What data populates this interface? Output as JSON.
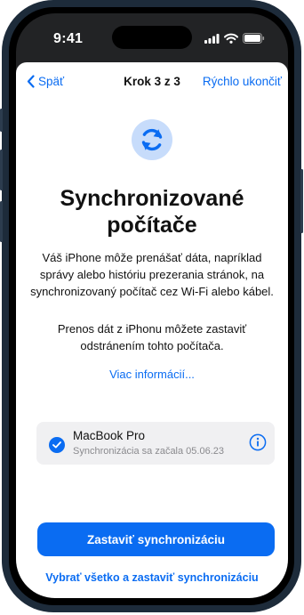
{
  "status_bar": {
    "time": "9:41"
  },
  "nav": {
    "back_label": "Späť",
    "title": "Krok 3 z 3",
    "action_label": "Rýchlo ukončiť"
  },
  "main": {
    "icon": "sync-icon",
    "heading_line1": "Synchronizované",
    "heading_line2": "počítače",
    "description": "Váš iPhone môže prenášať dáta, napríklad správy alebo históriu prezerania stránok, na synchronizovaný počítač cez Wi-Fi alebo kábel.",
    "description_2": "Prenos dát z iPhonu môžete zastaviť odstránením tohto počítača.",
    "more_link": "Viac informácií..."
  },
  "device": {
    "name": "MacBook Pro",
    "status": "Synchronizácia sa začala 05.06.23",
    "selected": true
  },
  "actions": {
    "primary": "Zastaviť synchronizáciu",
    "secondary": "Vybrať všetko a zastaviť synchronizáciu"
  },
  "colors": {
    "accent": "#0a6cf2",
    "icon_bg": "#c7dcfb",
    "card_bg": "#f0f0f2",
    "frame": "#1d2b3a"
  }
}
